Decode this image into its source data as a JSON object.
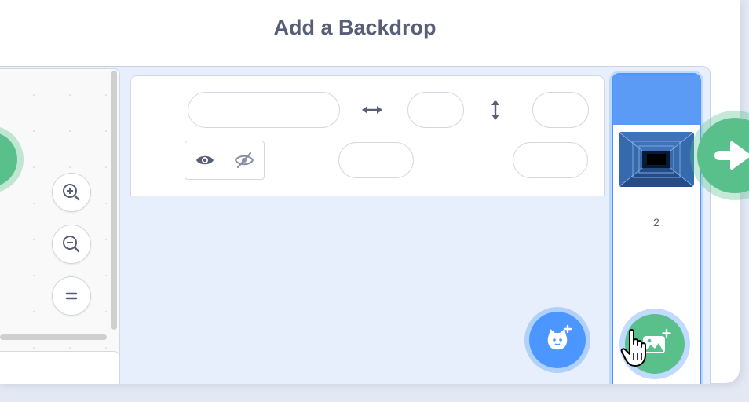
{
  "dialog": {
    "title": "Add a Backdrop"
  },
  "code_area": {
    "zoom_in": "zoom-in-icon",
    "zoom_out": "zoom-out-icon",
    "zoom_reset": "zoom-reset-icon"
  },
  "sprite_info": {
    "name_value": "",
    "x_value": "",
    "y_value": "",
    "size_value": "",
    "direction_value": "",
    "show_icon": "eye-icon",
    "hide_icon": "eye-slash-icon",
    "x_arrow_icon": "horizontal-arrows-icon",
    "y_arrow_icon": "vertical-arrows-icon"
  },
  "stage_selector": {
    "backdrop_count": "2"
  },
  "colors": {
    "green": "#59c08b",
    "blue": "#4c97ff",
    "text": "#575e75"
  }
}
